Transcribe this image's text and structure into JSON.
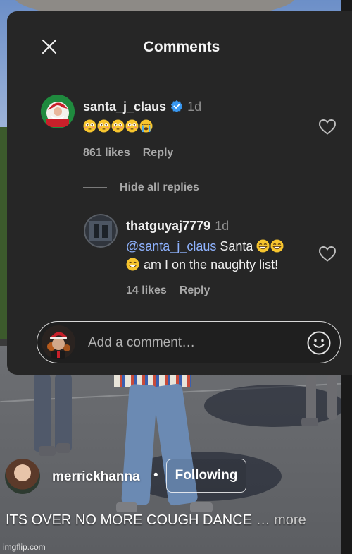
{
  "sheet": {
    "title": "Comments"
  },
  "comments": [
    {
      "username": "santa_j_claus",
      "time": "1d",
      "verified": true,
      "likes": "861 likes",
      "reply_label": "Reply"
    }
  ],
  "thread": {
    "hide_label": "Hide all replies"
  },
  "replies": [
    {
      "username": "thatguyaj7779",
      "time": "1d",
      "mention": "@santa_j_claus",
      "text_1": "Santa",
      "text_2": "am I on the naughty list!",
      "likes": "14 likes",
      "reply_label": "Reply"
    }
  ],
  "input": {
    "placeholder": "Add a comment…"
  },
  "post": {
    "owner": "merrickhanna",
    "separator": "•",
    "follow_label": "Following",
    "caption": "ITS OVER NO MORE COUGH DANCE",
    "more_label": "… more"
  },
  "watermark": "imgflip.com",
  "colors": {
    "sheet_bg": "#262626",
    "mention": "#8fb3ff",
    "verified": "#3897f0",
    "muted": "#a8a8a8"
  }
}
